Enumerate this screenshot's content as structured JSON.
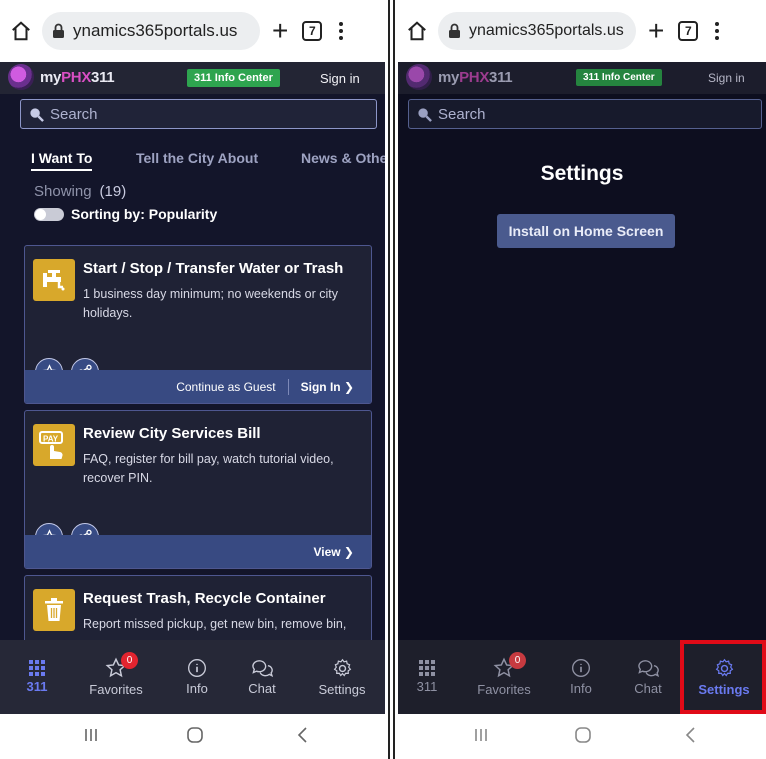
{
  "browser": {
    "url": "ynamics365portals.us",
    "tab_count": "7"
  },
  "header": {
    "logo_prefix": "my",
    "logo_brand": "PHX",
    "logo_suffix": "311",
    "info_center": "311 Info Center",
    "sign_in": "Sign in"
  },
  "search": {
    "placeholder": "Search"
  },
  "left_screen": {
    "tabs": [
      "I Want To",
      "Tell the City About",
      "News & Othe"
    ],
    "showing_label": "Showing",
    "showing_count": "(19)",
    "sorting_label": "Sorting by: Popularity",
    "cards": [
      {
        "title": "Start / Stop / Transfer Water or Trash",
        "desc": "1 business day minimum; no weekends or city holidays.",
        "footer_guest": "Continue as Guest",
        "footer_signin": "Sign In ❯",
        "icon": "water-tap-icon"
      },
      {
        "title": "Review City Services Bill",
        "desc": "FAQ, register for bill pay, watch tutorial video, recover PIN.",
        "footer_view": "View ❯",
        "icon": "pay-icon"
      },
      {
        "title": "Request Trash, Recycle Container",
        "desc": "Report missed pickup, get new bin, remove bin,",
        "icon": "trash-icon"
      }
    ]
  },
  "right_screen": {
    "title": "Settings",
    "install_button": "Install on Home Screen"
  },
  "nav": {
    "item_311": "311",
    "favorites": "Favorites",
    "favorites_badge": "0",
    "info": "Info",
    "chat": "Chat",
    "settings": "Settings"
  },
  "colors": {
    "app_bg": "#13152a",
    "accent_green": "#2ea44f",
    "brand_pink": "#d94fc4",
    "active_nav": "#6a7af0",
    "highlight_red": "#e00a17",
    "card_icon_gold": "#d8a82b"
  }
}
